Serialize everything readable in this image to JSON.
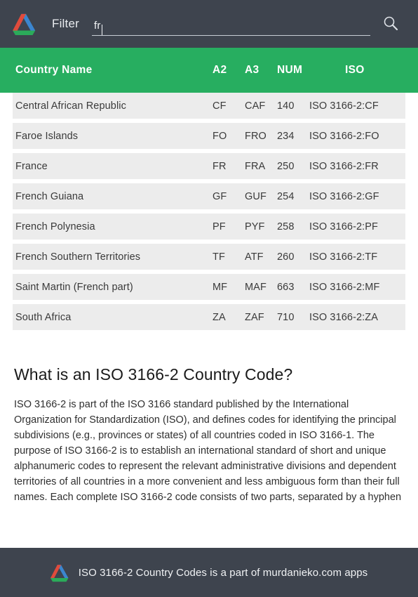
{
  "app": {
    "title": "ISO 3166-2 Country Codes",
    "logo_icon": "drive-triangle-logo",
    "colors": {
      "topbar": "#3e444e",
      "accent_green": "#27ae60",
      "row_bg": "#ececec",
      "logo_red": "#e04b3c",
      "logo_blue": "#3b86cf",
      "logo_green": "#2bab5a"
    }
  },
  "toolbar": {
    "filter_label": "Filter",
    "filter_value": "fr",
    "filter_placeholder": "",
    "search_icon": "search-icon"
  },
  "table": {
    "columns": [
      {
        "key": "name",
        "label": "Country Name"
      },
      {
        "key": "a2",
        "label": "A2"
      },
      {
        "key": "a3",
        "label": "A3"
      },
      {
        "key": "num",
        "label": "NUM"
      },
      {
        "key": "iso",
        "label": "ISO"
      }
    ],
    "rows": [
      {
        "name": "Central African Republic",
        "a2": "CF",
        "a3": "CAF",
        "num": "140",
        "iso": "ISO 3166-2:CF"
      },
      {
        "name": "Faroe Islands",
        "a2": "FO",
        "a3": "FRO",
        "num": "234",
        "iso": "ISO 3166-2:FO"
      },
      {
        "name": "France",
        "a2": "FR",
        "a3": "FRA",
        "num": "250",
        "iso": "ISO 3166-2:FR"
      },
      {
        "name": "French Guiana",
        "a2": "GF",
        "a3": "GUF",
        "num": "254",
        "iso": "ISO 3166-2:GF"
      },
      {
        "name": "French Polynesia",
        "a2": "PF",
        "a3": "PYF",
        "num": "258",
        "iso": "ISO 3166-2:PF"
      },
      {
        "name": "French Southern Territories",
        "a2": "TF",
        "a3": "ATF",
        "num": "260",
        "iso": "ISO 3166-2:TF"
      },
      {
        "name": "Saint Martin (French part)",
        "a2": "MF",
        "a3": "MAF",
        "num": "663",
        "iso": "ISO 3166-2:MF"
      },
      {
        "name": "South Africa",
        "a2": "ZA",
        "a3": "ZAF",
        "num": "710",
        "iso": "ISO 3166-2:ZA"
      }
    ]
  },
  "article": {
    "heading": "What is an ISO 3166-2 Country Code?",
    "body": "ISO 3166-2 is part of the ISO 3166 standard published by the International Organization for Standardization (ISO), and defines codes for identifying the principal subdivisions (e.g., provinces or states) of all countries coded in ISO 3166-1. The purpose of ISO 3166-2 is to establish an international standard of short and unique alphanumeric codes to represent the relevant administrative divisions and dependent territories of all countries in a more convenient and less ambiguous form than their full names. Each complete ISO 3166-2 code consists of two parts, separated by a hyphen"
  },
  "footer": {
    "logo_icon": "drive-triangle-logo",
    "text": "ISO 3166-2 Country Codes is a part of murdanieko.com apps"
  }
}
